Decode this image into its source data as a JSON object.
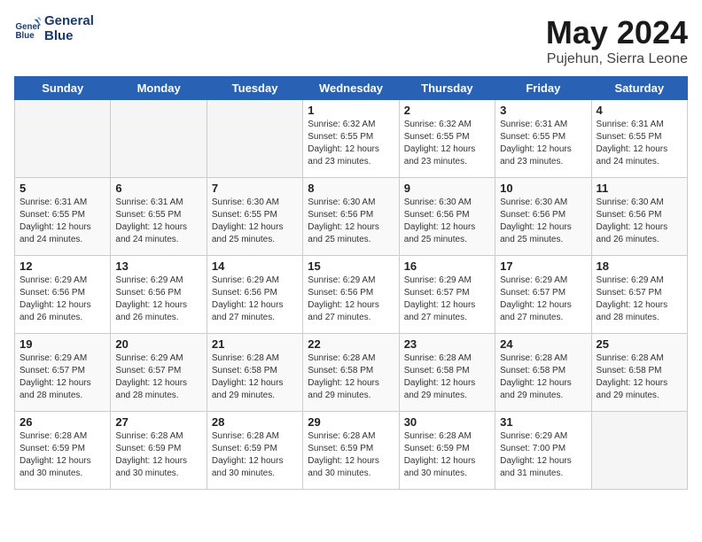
{
  "header": {
    "logo_line1": "General",
    "logo_line2": "Blue",
    "title": "May 2024",
    "subtitle": "Pujehun, Sierra Leone"
  },
  "weekdays": [
    "Sunday",
    "Monday",
    "Tuesday",
    "Wednesday",
    "Thursday",
    "Friday",
    "Saturday"
  ],
  "weeks": [
    [
      {
        "day": "",
        "info": ""
      },
      {
        "day": "",
        "info": ""
      },
      {
        "day": "",
        "info": ""
      },
      {
        "day": "1",
        "info": "Sunrise: 6:32 AM\nSunset: 6:55 PM\nDaylight: 12 hours\nand 23 minutes."
      },
      {
        "day": "2",
        "info": "Sunrise: 6:32 AM\nSunset: 6:55 PM\nDaylight: 12 hours\nand 23 minutes."
      },
      {
        "day": "3",
        "info": "Sunrise: 6:31 AM\nSunset: 6:55 PM\nDaylight: 12 hours\nand 23 minutes."
      },
      {
        "day": "4",
        "info": "Sunrise: 6:31 AM\nSunset: 6:55 PM\nDaylight: 12 hours\nand 24 minutes."
      }
    ],
    [
      {
        "day": "5",
        "info": "Sunrise: 6:31 AM\nSunset: 6:55 PM\nDaylight: 12 hours\nand 24 minutes."
      },
      {
        "day": "6",
        "info": "Sunrise: 6:31 AM\nSunset: 6:55 PM\nDaylight: 12 hours\nand 24 minutes."
      },
      {
        "day": "7",
        "info": "Sunrise: 6:30 AM\nSunset: 6:55 PM\nDaylight: 12 hours\nand 25 minutes."
      },
      {
        "day": "8",
        "info": "Sunrise: 6:30 AM\nSunset: 6:56 PM\nDaylight: 12 hours\nand 25 minutes."
      },
      {
        "day": "9",
        "info": "Sunrise: 6:30 AM\nSunset: 6:56 PM\nDaylight: 12 hours\nand 25 minutes."
      },
      {
        "day": "10",
        "info": "Sunrise: 6:30 AM\nSunset: 6:56 PM\nDaylight: 12 hours\nand 25 minutes."
      },
      {
        "day": "11",
        "info": "Sunrise: 6:30 AM\nSunset: 6:56 PM\nDaylight: 12 hours\nand 26 minutes."
      }
    ],
    [
      {
        "day": "12",
        "info": "Sunrise: 6:29 AM\nSunset: 6:56 PM\nDaylight: 12 hours\nand 26 minutes."
      },
      {
        "day": "13",
        "info": "Sunrise: 6:29 AM\nSunset: 6:56 PM\nDaylight: 12 hours\nand 26 minutes."
      },
      {
        "day": "14",
        "info": "Sunrise: 6:29 AM\nSunset: 6:56 PM\nDaylight: 12 hours\nand 27 minutes."
      },
      {
        "day": "15",
        "info": "Sunrise: 6:29 AM\nSunset: 6:56 PM\nDaylight: 12 hours\nand 27 minutes."
      },
      {
        "day": "16",
        "info": "Sunrise: 6:29 AM\nSunset: 6:57 PM\nDaylight: 12 hours\nand 27 minutes."
      },
      {
        "day": "17",
        "info": "Sunrise: 6:29 AM\nSunset: 6:57 PM\nDaylight: 12 hours\nand 27 minutes."
      },
      {
        "day": "18",
        "info": "Sunrise: 6:29 AM\nSunset: 6:57 PM\nDaylight: 12 hours\nand 28 minutes."
      }
    ],
    [
      {
        "day": "19",
        "info": "Sunrise: 6:29 AM\nSunset: 6:57 PM\nDaylight: 12 hours\nand 28 minutes."
      },
      {
        "day": "20",
        "info": "Sunrise: 6:29 AM\nSunset: 6:57 PM\nDaylight: 12 hours\nand 28 minutes."
      },
      {
        "day": "21",
        "info": "Sunrise: 6:28 AM\nSunset: 6:58 PM\nDaylight: 12 hours\nand 29 minutes."
      },
      {
        "day": "22",
        "info": "Sunrise: 6:28 AM\nSunset: 6:58 PM\nDaylight: 12 hours\nand 29 minutes."
      },
      {
        "day": "23",
        "info": "Sunrise: 6:28 AM\nSunset: 6:58 PM\nDaylight: 12 hours\nand 29 minutes."
      },
      {
        "day": "24",
        "info": "Sunrise: 6:28 AM\nSunset: 6:58 PM\nDaylight: 12 hours\nand 29 minutes."
      },
      {
        "day": "25",
        "info": "Sunrise: 6:28 AM\nSunset: 6:58 PM\nDaylight: 12 hours\nand 29 minutes."
      }
    ],
    [
      {
        "day": "26",
        "info": "Sunrise: 6:28 AM\nSunset: 6:59 PM\nDaylight: 12 hours\nand 30 minutes."
      },
      {
        "day": "27",
        "info": "Sunrise: 6:28 AM\nSunset: 6:59 PM\nDaylight: 12 hours\nand 30 minutes."
      },
      {
        "day": "28",
        "info": "Sunrise: 6:28 AM\nSunset: 6:59 PM\nDaylight: 12 hours\nand 30 minutes."
      },
      {
        "day": "29",
        "info": "Sunrise: 6:28 AM\nSunset: 6:59 PM\nDaylight: 12 hours\nand 30 minutes."
      },
      {
        "day": "30",
        "info": "Sunrise: 6:28 AM\nSunset: 6:59 PM\nDaylight: 12 hours\nand 30 minutes."
      },
      {
        "day": "31",
        "info": "Sunrise: 6:29 AM\nSunset: 7:00 PM\nDaylight: 12 hours\nand 31 minutes."
      },
      {
        "day": "",
        "info": ""
      }
    ]
  ]
}
